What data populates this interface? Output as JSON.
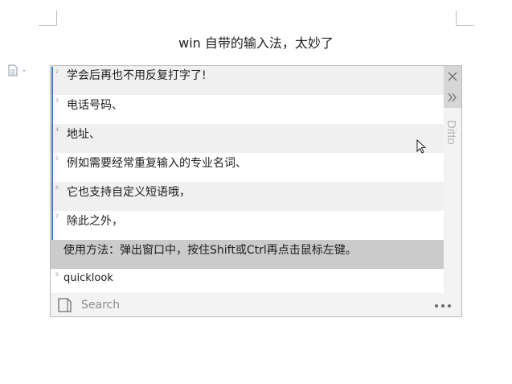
{
  "document": {
    "title": "win 自带的输入法，太妙了"
  },
  "sidebar": {
    "icon": "document-icon"
  },
  "clipboard": {
    "items": [
      {
        "num": "2",
        "text": "学会后再也不用反复打字了!"
      },
      {
        "num": "3",
        "text": "电话号码、"
      },
      {
        "num": "4",
        "text": "地址、"
      },
      {
        "num": "5",
        "text": "例如需要经常重复输入的专业名词、"
      },
      {
        "num": "6",
        "text": "它也支持自定义短语哦，"
      },
      {
        "num": "7",
        "text": "除此之外，"
      },
      {
        "num": "8",
        "text": "使用方法：弹出窗口中，按住Shift或Ctrl再点击鼠标左键。"
      },
      {
        "num": "9",
        "text": "quicklook"
      }
    ],
    "selected_index": 6,
    "app_label": "Ditto",
    "search_placeholder": "Search",
    "colors": {
      "selection": "#cbcbcb",
      "accent": "#3d7bd1",
      "panel": "#f3f3f3"
    }
  }
}
